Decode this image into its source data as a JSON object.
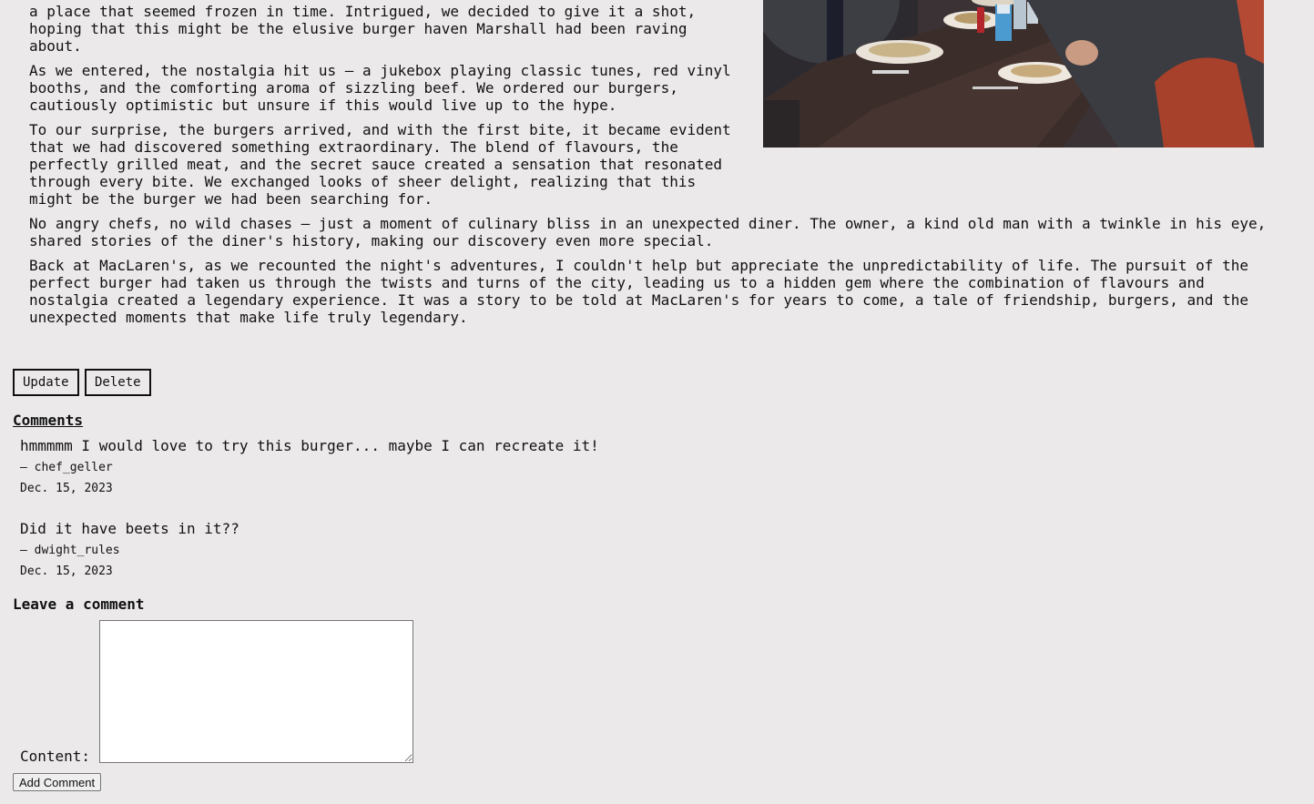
{
  "article": {
    "paragraphs": [
      "a place that seemed frozen in time. Intrigued, we decided to give it a shot,\nhoping that this might be the elusive burger haven Marshall had been raving\nabout.",
      "As we entered, the nostalgia hit us – a jukebox playing classic tunes, red vinyl\nbooths, and the comforting aroma of sizzling beef. We ordered our burgers,\ncautiously optimistic but unsure if this would live up to the hype.",
      "To our surprise, the burgers arrived, and with the first bite, it became evident\nthat we had discovered something extraordinary. The blend of flavours, the\nperfectly grilled meat, and the secret sauce created a sensation that resonated\nthrough every bite. We exchanged looks of sheer delight, realizing that this\nmight be the burger we had been searching for.",
      "No angry chefs, no wild chases – just a moment of culinary bliss in an unexpected diner. The owner, a kind old man with a twinkle in his eye,\nshared stories of the diner's history, making our discovery even more special.",
      "Back at MacLaren's, as we recounted the night's adventures, I couldn't help but appreciate the unpredictability of life. The pursuit of the\nperfect burger had taken us through the twists and turns of the city, leading us to a hidden gem where the combination of flavours and\nnostalgia created a legendary experience. It was a story to be told at MacLaren's for years to come, a tale of friendship, burgers, and the\nunexpected moments that make life truly legendary."
    ]
  },
  "actions": {
    "update_label": "Update",
    "delete_label": "Delete"
  },
  "comments": {
    "heading": "Comments",
    "items": [
      {
        "text": "hmmmmm I would love to try this burger... maybe I can recreate it!",
        "author": "– chef_geller",
        "date": "Dec. 15, 2023"
      },
      {
        "text": "Did it have beets in it??",
        "author": "– dwight_rules",
        "date": "Dec. 15, 2023"
      }
    ]
  },
  "comment_form": {
    "heading": "Leave a comment",
    "content_label": "Content:",
    "content_value": "",
    "submit_label": "Add Comment"
  },
  "colors": {
    "background": "#ece9ea",
    "text": "#111111"
  }
}
